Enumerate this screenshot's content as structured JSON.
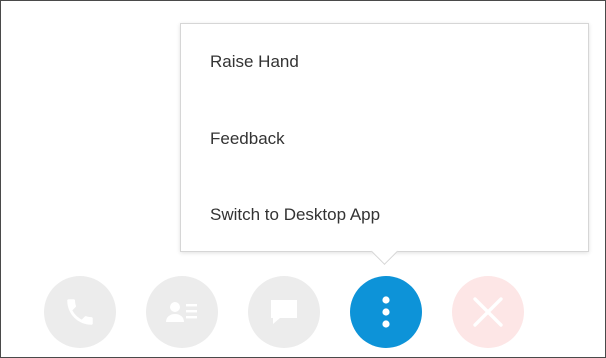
{
  "menu": {
    "items": [
      {
        "label": "Raise Hand"
      },
      {
        "label": "Feedback"
      },
      {
        "label": "Switch to Desktop App"
      }
    ]
  },
  "controls": [
    {
      "name": "call",
      "icon": "phone-icon",
      "state": "disabled"
    },
    {
      "name": "contacts",
      "icon": "contact-card-icon",
      "state": "disabled"
    },
    {
      "name": "chat",
      "icon": "chat-bubble-icon",
      "state": "disabled"
    },
    {
      "name": "more",
      "icon": "more-vertical-icon",
      "state": "active"
    },
    {
      "name": "end",
      "icon": "close-icon",
      "state": "disabled"
    }
  ],
  "colors": {
    "disabled_button": "#ececec",
    "disabled_icon": "#ffffff",
    "active_button": "#0d93d8",
    "active_icon": "#ffffff",
    "end_button": "#fde6e6",
    "end_icon": "#ffffff",
    "menu_text": "#333333",
    "menu_border": "#d6d6d6"
  }
}
